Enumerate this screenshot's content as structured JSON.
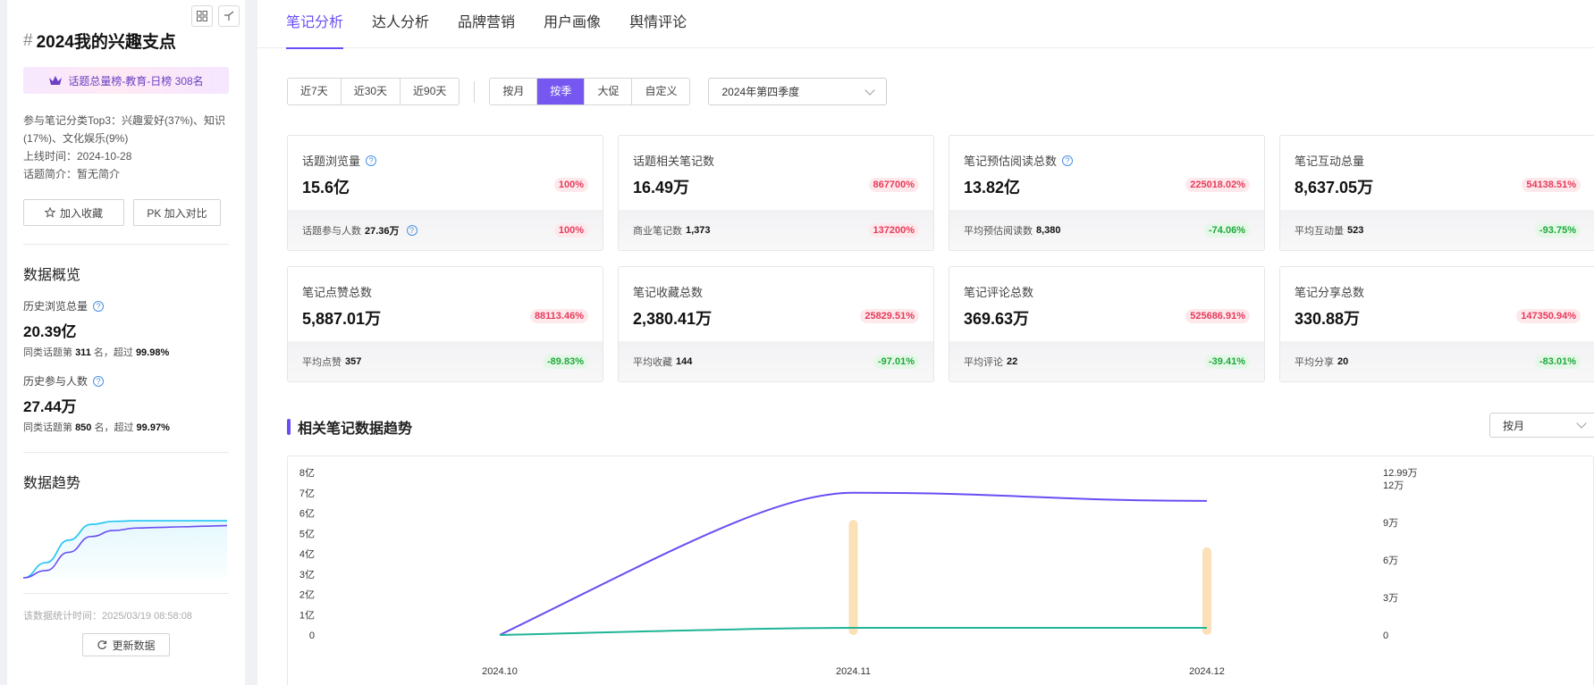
{
  "sidebar": {
    "title_hash": "#",
    "title": "2024我的兴趣支点",
    "rank_banner": "话题总量榜-教育-日榜 308名",
    "meta_lines": [
      "参与笔记分类Top3：兴趣爱好(37%)、知识(17%)、文化娱乐(9%)",
      "上线时间：2024-10-28",
      "话题简介：暂无简介"
    ],
    "collect_label": "加入收藏",
    "pk_label": "PK 加入对比",
    "overview_title": "数据概览",
    "hist_views_label": "历史浏览总量",
    "hist_views_value": "20.39亿",
    "hist_views_rank_pre": "同类话题第",
    "hist_views_rank": "311",
    "hist_views_rank_mid": "名，超过",
    "hist_views_pct": "99.98%",
    "hist_users_label": "历史参与人数",
    "hist_users_value": "27.44万",
    "hist_users_rank_pre": "同类话题第",
    "hist_users_rank": "850",
    "hist_users_rank_mid": "名，超过",
    "hist_users_pct": "99.97%",
    "trend_title": "数据趋势",
    "stat_time": "该数据统计时间：2025/03/19 08:58:08",
    "refresh_label": "更新数据",
    "mini_chart": {
      "series": [
        {
          "color": "#1ec3f2",
          "values": [
            0,
            0.25,
            0.62,
            0.88,
            0.93,
            0.94,
            0.94,
            0.94,
            0.94,
            0.94
          ]
        },
        {
          "color": "#6a4df4",
          "values": [
            0,
            0.12,
            0.42,
            0.68,
            0.78,
            0.82,
            0.83,
            0.84,
            0.85,
            0.86
          ]
        }
      ]
    }
  },
  "tabs": [
    "笔记分析",
    "达人分析",
    "品牌营销",
    "用户画像",
    "舆情评论"
  ],
  "filters": {
    "range": [
      "近7天",
      "近30天",
      "近90天"
    ],
    "period": [
      "按月",
      "按季",
      "大促",
      "自定义"
    ],
    "period_active": 1,
    "select_value": "2024年第四季度"
  },
  "cards": [
    {
      "label": "话题浏览量",
      "help": true,
      "value": "15.6亿",
      "badge": "100%",
      "dir": "up",
      "sub_label": "话题参与人数",
      "sub_value": "27.36万",
      "sub_help": true,
      "sub_badge": "100%",
      "sub_dir": "up"
    },
    {
      "label": "话题相关笔记数",
      "help": false,
      "value": "16.49万",
      "badge": "867700%",
      "dir": "up",
      "sub_label": "商业笔记数",
      "sub_value": "1,373",
      "sub_help": false,
      "sub_badge": "137200%",
      "sub_dir": "up"
    },
    {
      "label": "笔记预估阅读总数",
      "help": true,
      "value": "13.82亿",
      "badge": "225018.02%",
      "dir": "up",
      "sub_label": "平均预估阅读数",
      "sub_value": "8,380",
      "sub_help": false,
      "sub_badge": "-74.06%",
      "sub_dir": "down"
    },
    {
      "label": "笔记互动总量",
      "help": false,
      "value": "8,637.05万",
      "badge": "54138.51%",
      "dir": "up",
      "sub_label": "平均互动量",
      "sub_value": "523",
      "sub_help": false,
      "sub_badge": "-93.75%",
      "sub_dir": "down"
    },
    {
      "label": "笔记点赞总数",
      "help": false,
      "value": "5,887.01万",
      "badge": "88113.46%",
      "dir": "up",
      "sub_label": "平均点赞",
      "sub_value": "357",
      "sub_help": false,
      "sub_badge": "-89.83%",
      "sub_dir": "down"
    },
    {
      "label": "笔记收藏总数",
      "help": false,
      "value": "2,380.41万",
      "badge": "25829.51%",
      "dir": "up",
      "sub_label": "平均收藏",
      "sub_value": "144",
      "sub_help": false,
      "sub_badge": "-97.01%",
      "sub_dir": "down"
    },
    {
      "label": "笔记评论总数",
      "help": false,
      "value": "369.63万",
      "badge": "525686.91%",
      "dir": "up",
      "sub_label": "平均评论",
      "sub_value": "22",
      "sub_help": false,
      "sub_badge": "-39.41%",
      "sub_dir": "down"
    },
    {
      "label": "笔记分享总数",
      "help": false,
      "value": "330.88万",
      "badge": "147350.94%",
      "dir": "up",
      "sub_label": "平均分享",
      "sub_value": "20",
      "sub_help": false,
      "sub_badge": "-83.01%",
      "sub_dir": "down"
    }
  ],
  "trend": {
    "title": "相关笔记数据趋势",
    "select_value": "按月"
  },
  "chart_data": {
    "type": "line",
    "x": [
      "2024.10",
      "2024.11",
      "2024.12"
    ],
    "left_ticks": [
      "0",
      "1亿",
      "2亿",
      "3亿",
      "4亿",
      "5亿",
      "6亿",
      "7亿",
      "8亿"
    ],
    "left_range": [
      0,
      8
    ],
    "right_ticks": [
      "0",
      "3万",
      "6万",
      "9万",
      "12万"
    ],
    "right_top_label": "12.99万",
    "right_range": [
      0,
      12.99
    ],
    "series": [
      {
        "color": "#6a4df4",
        "axis": "left",
        "values": [
          0,
          7.0,
          6.6
        ]
      },
      {
        "color": "#1fb597",
        "axis": "left",
        "values": [
          0,
          0.35,
          0.35
        ]
      },
      {
        "color": "#fce0b8",
        "axis": "right",
        "type": "bar",
        "values": [
          0,
          9.2,
          7.0
        ]
      }
    ]
  },
  "colors": {
    "accent": "#6a4df4",
    "up": "#e83a5a",
    "down": "#1ea83a"
  }
}
